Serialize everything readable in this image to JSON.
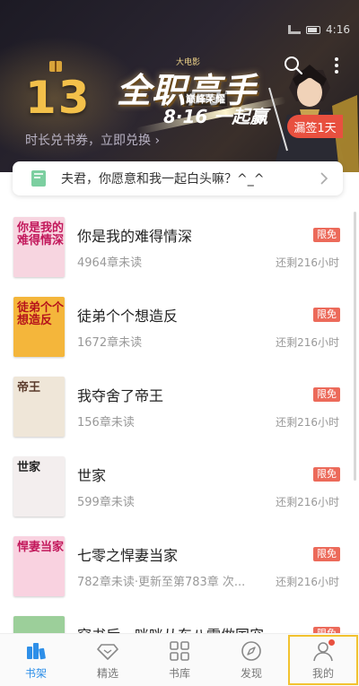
{
  "status": {
    "time": "4:16"
  },
  "banner": {
    "number": "13",
    "title_art": "全职高手",
    "title_small": "大电影",
    "title_sub": "巅峰荣耀",
    "date_art": "8·16 一起赢",
    "exchange": "时长兑书券，立即兑换 ›",
    "checkin": "漏签1天",
    "icons": [
      "search-icon",
      "more-icon"
    ]
  },
  "message": {
    "text": "夫君，你愿意和我一起白头嘛？^_^"
  },
  "books": [
    {
      "title": "你是我的难得情深",
      "meta": "4964章未读",
      "tag": "限免",
      "remain": "还剩216小时",
      "cover_text": "你是我的难得情深",
      "cover_color": "#f7d5e0",
      "cover_text_color": "#c2185b"
    },
    {
      "title": "徒弟个个想造反",
      "meta": "1672章未读",
      "tag": "限免",
      "remain": "还剩216小时",
      "cover_text": "徒弟个个想造反",
      "cover_color": "#f4b63b",
      "cover_text_color": "#b5121b"
    },
    {
      "title": "我夺舍了帝王",
      "meta": "156章未读",
      "tag": "限免",
      "remain": "还剩216小时",
      "cover_text": "帝王",
      "cover_color": "#efe6d8",
      "cover_text_color": "#5a3a2a"
    },
    {
      "title": "世家",
      "meta": "599章未读",
      "tag": "限免",
      "remain": "还剩216小时",
      "cover_text": "世家",
      "cover_color": "#f3eeee",
      "cover_text_color": "#222"
    },
    {
      "title": "七零之悍妻当家",
      "meta": "782章未读·更新至第783章 次...",
      "tag": "限免",
      "remain": "还剩216小时",
      "cover_text": "悍妻当家",
      "cover_color": "#f9d2e0",
      "cover_text_color": "#c2185b"
    },
    {
      "title": "穿书后，咪咪从东八零做国宠",
      "meta": "",
      "tag": "限免",
      "remain": "",
      "cover_text": "",
      "cover_color": "#9ccf9a",
      "cover_text_color": "#fff"
    }
  ],
  "nav": [
    {
      "label": "书架",
      "icon": "bookshelf-icon",
      "active": true
    },
    {
      "label": "精选",
      "icon": "diamond-icon",
      "active": false
    },
    {
      "label": "书库",
      "icon": "grid-icon",
      "active": false
    },
    {
      "label": "发现",
      "icon": "compass-icon",
      "active": false
    },
    {
      "label": "我的",
      "icon": "user-icon",
      "active": false
    }
  ],
  "colors": {
    "accent": "#2e8fe8",
    "tag_red": "#ec6a5a",
    "checkin_red": "#e8503f",
    "gold": "#f3c04a"
  }
}
